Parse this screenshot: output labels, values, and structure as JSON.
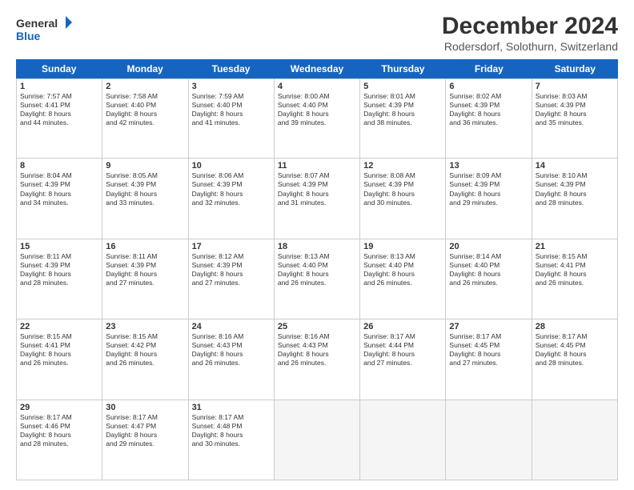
{
  "logo": {
    "line1": "General",
    "line2": "Blue"
  },
  "title": "December 2024",
  "subtitle": "Rodersdorf, Solothurn, Switzerland",
  "header_days": [
    "Sunday",
    "Monday",
    "Tuesday",
    "Wednesday",
    "Thursday",
    "Friday",
    "Saturday"
  ],
  "weeks": [
    [
      {
        "day": "1",
        "text": "Sunrise: 7:57 AM\nSunset: 4:41 PM\nDaylight: 8 hours\nand 44 minutes."
      },
      {
        "day": "2",
        "text": "Sunrise: 7:58 AM\nSunset: 4:40 PM\nDaylight: 8 hours\nand 42 minutes."
      },
      {
        "day": "3",
        "text": "Sunrise: 7:59 AM\nSunset: 4:40 PM\nDaylight: 8 hours\nand 41 minutes."
      },
      {
        "day": "4",
        "text": "Sunrise: 8:00 AM\nSunset: 4:40 PM\nDaylight: 8 hours\nand 39 minutes."
      },
      {
        "day": "5",
        "text": "Sunrise: 8:01 AM\nSunset: 4:39 PM\nDaylight: 8 hours\nand 38 minutes."
      },
      {
        "day": "6",
        "text": "Sunrise: 8:02 AM\nSunset: 4:39 PM\nDaylight: 8 hours\nand 36 minutes."
      },
      {
        "day": "7",
        "text": "Sunrise: 8:03 AM\nSunset: 4:39 PM\nDaylight: 8 hours\nand 35 minutes."
      }
    ],
    [
      {
        "day": "8",
        "text": "Sunrise: 8:04 AM\nSunset: 4:39 PM\nDaylight: 8 hours\nand 34 minutes."
      },
      {
        "day": "9",
        "text": "Sunrise: 8:05 AM\nSunset: 4:39 PM\nDaylight: 8 hours\nand 33 minutes."
      },
      {
        "day": "10",
        "text": "Sunrise: 8:06 AM\nSunset: 4:39 PM\nDaylight: 8 hours\nand 32 minutes."
      },
      {
        "day": "11",
        "text": "Sunrise: 8:07 AM\nSunset: 4:39 PM\nDaylight: 8 hours\nand 31 minutes."
      },
      {
        "day": "12",
        "text": "Sunrise: 8:08 AM\nSunset: 4:39 PM\nDaylight: 8 hours\nand 30 minutes."
      },
      {
        "day": "13",
        "text": "Sunrise: 8:09 AM\nSunset: 4:39 PM\nDaylight: 8 hours\nand 29 minutes."
      },
      {
        "day": "14",
        "text": "Sunrise: 8:10 AM\nSunset: 4:39 PM\nDaylight: 8 hours\nand 28 minutes."
      }
    ],
    [
      {
        "day": "15",
        "text": "Sunrise: 8:11 AM\nSunset: 4:39 PM\nDaylight: 8 hours\nand 28 minutes."
      },
      {
        "day": "16",
        "text": "Sunrise: 8:11 AM\nSunset: 4:39 PM\nDaylight: 8 hours\nand 27 minutes."
      },
      {
        "day": "17",
        "text": "Sunrise: 8:12 AM\nSunset: 4:39 PM\nDaylight: 8 hours\nand 27 minutes."
      },
      {
        "day": "18",
        "text": "Sunrise: 8:13 AM\nSunset: 4:40 PM\nDaylight: 8 hours\nand 26 minutes."
      },
      {
        "day": "19",
        "text": "Sunrise: 8:13 AM\nSunset: 4:40 PM\nDaylight: 8 hours\nand 26 minutes."
      },
      {
        "day": "20",
        "text": "Sunrise: 8:14 AM\nSunset: 4:40 PM\nDaylight: 8 hours\nand 26 minutes."
      },
      {
        "day": "21",
        "text": "Sunrise: 8:15 AM\nSunset: 4:41 PM\nDaylight: 8 hours\nand 26 minutes."
      }
    ],
    [
      {
        "day": "22",
        "text": "Sunrise: 8:15 AM\nSunset: 4:41 PM\nDaylight: 8 hours\nand 26 minutes."
      },
      {
        "day": "23",
        "text": "Sunrise: 8:15 AM\nSunset: 4:42 PM\nDaylight: 8 hours\nand 26 minutes."
      },
      {
        "day": "24",
        "text": "Sunrise: 8:16 AM\nSunset: 4:43 PM\nDaylight: 8 hours\nand 26 minutes."
      },
      {
        "day": "25",
        "text": "Sunrise: 8:16 AM\nSunset: 4:43 PM\nDaylight: 8 hours\nand 26 minutes."
      },
      {
        "day": "26",
        "text": "Sunrise: 8:17 AM\nSunset: 4:44 PM\nDaylight: 8 hours\nand 27 minutes."
      },
      {
        "day": "27",
        "text": "Sunrise: 8:17 AM\nSunset: 4:45 PM\nDaylight: 8 hours\nand 27 minutes."
      },
      {
        "day": "28",
        "text": "Sunrise: 8:17 AM\nSunset: 4:45 PM\nDaylight: 8 hours\nand 28 minutes."
      }
    ],
    [
      {
        "day": "29",
        "text": "Sunrise: 8:17 AM\nSunset: 4:46 PM\nDaylight: 8 hours\nand 28 minutes."
      },
      {
        "day": "30",
        "text": "Sunrise: 8:17 AM\nSunset: 4:47 PM\nDaylight: 8 hours\nand 29 minutes."
      },
      {
        "day": "31",
        "text": "Sunrise: 8:17 AM\nSunset: 4:48 PM\nDaylight: 8 hours\nand 30 minutes."
      },
      {
        "day": "",
        "text": ""
      },
      {
        "day": "",
        "text": ""
      },
      {
        "day": "",
        "text": ""
      },
      {
        "day": "",
        "text": ""
      }
    ]
  ]
}
